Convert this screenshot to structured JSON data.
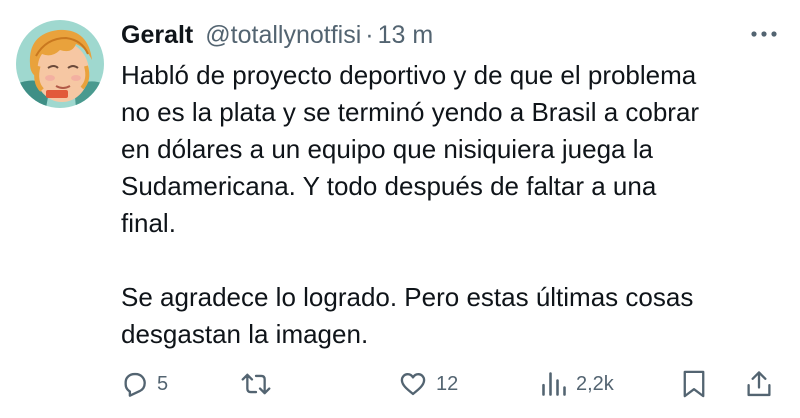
{
  "user": {
    "display_name": "Geralt",
    "handle": "@totallynotfisi",
    "separator": "·",
    "time": "13 m",
    "avatar_icon": "avatar-illustration"
  },
  "tweet": {
    "paragraphs": [
      [
        "Habló de proyecto deportivo y de que el problema",
        "no es la plata y se terminó yendo a Brasil a cobrar",
        "en dólares a un equipo que nisiquiera juega la",
        "Sudamericana. Y todo después de faltar a una",
        "final."
      ],
      [
        "Se agradece lo logrado. Pero estas últimas cosas",
        "desgastan la imagen."
      ]
    ]
  },
  "actions": {
    "reply": {
      "icon": "reply-icon",
      "count": "5"
    },
    "retweet": {
      "icon": "retweet-icon",
      "count": ""
    },
    "like": {
      "icon": "heart-icon",
      "count": "12"
    },
    "views": {
      "icon": "views-icon",
      "count": "2,2k"
    },
    "bookmark": {
      "icon": "bookmark-icon"
    },
    "share": {
      "icon": "share-icon"
    }
  },
  "colors": {
    "text": "#0f1419",
    "muted": "#536471",
    "background": "#ffffff"
  }
}
